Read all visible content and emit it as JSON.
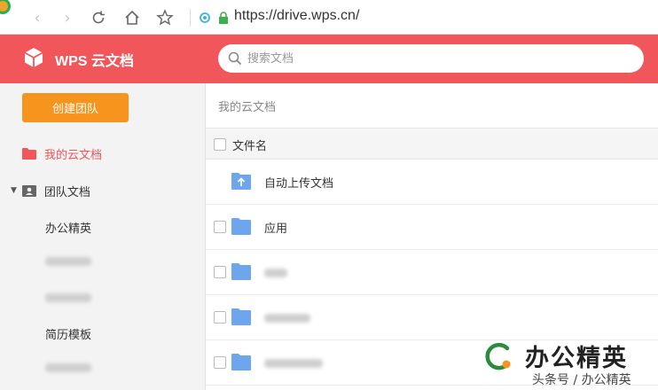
{
  "browser": {
    "url": "https://drive.wps.cn/",
    "icons": [
      "back-icon",
      "forward-icon",
      "reload-icon",
      "home-icon",
      "star-icon",
      "site-info-icon",
      "lock-icon"
    ]
  },
  "header": {
    "brand": "WPS 云文档",
    "search_placeholder": "搜索文档",
    "bg_color": "#f0565a"
  },
  "sidebar": {
    "create_button": "创建团队",
    "my_docs": "我的云文档",
    "team_docs": "团队文档",
    "teams": [
      "办公精英",
      "简历模板"
    ]
  },
  "main": {
    "breadcrumb": "我的云文档",
    "column_name": "文件名",
    "rows": [
      {
        "name": "自动上传文档"
      },
      {
        "name": "应用"
      }
    ]
  },
  "watermark": {
    "title": "办公精英",
    "subtitle": "头条号 / 办公精英"
  }
}
